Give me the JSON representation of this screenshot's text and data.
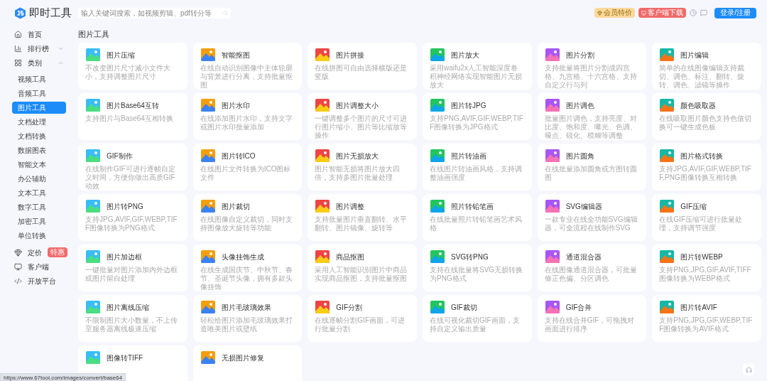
{
  "header": {
    "logo": "即时工具",
    "search": {
      "placeholder": "输入关键词搜索，如视频剪辑、pdf转分等"
    },
    "vip_button": "会员特价",
    "download_button": "客户端下载",
    "login_button": "登录/注册"
  },
  "sidebar": {
    "items": [
      {
        "label": "首页",
        "selected": false
      },
      {
        "label": "排行榜",
        "selected": false,
        "expanded": false
      },
      {
        "label": "类别",
        "selected": false,
        "expanded": true,
        "children": [
          {
            "label": "视频工具",
            "selected": false
          },
          {
            "label": "音频工具",
            "selected": false
          },
          {
            "label": "图片工具",
            "selected": true
          },
          {
            "label": "文档处理",
            "selected": false
          },
          {
            "label": "文档转换",
            "selected": false
          },
          {
            "label": "数据图表",
            "selected": false
          },
          {
            "label": "智能文本",
            "selected": false
          },
          {
            "label": "办公辅助",
            "selected": false
          },
          {
            "label": "文本工具",
            "selected": false
          },
          {
            "label": "数字工具",
            "selected": false
          },
          {
            "label": "加密工具",
            "selected": false
          },
          {
            "label": "单位转换",
            "selected": false
          }
        ]
      },
      {
        "label": "定价",
        "selected": false,
        "badge": "特惠"
      },
      {
        "label": "客户端",
        "selected": false
      },
      {
        "label": "开放平台",
        "selected": false
      }
    ]
  },
  "page_title": "图片工具",
  "tools": [
    {
      "title": "图片压缩",
      "description": "不改变图片尺寸减小文件大小，支持调整图片尺寸"
    },
    {
      "title": "智能抠图",
      "description": "在线自动识别图像中主体轮廓与背景进行分离，支持批量抠图"
    },
    {
      "title": "图片拼接",
      "description": "在线拼图可自由选择横版还是竖版"
    },
    {
      "title": "图片放大",
      "description": "采用waifu2x人工智能深度卷积神经网络实现智能图片无损放大"
    },
    {
      "title": "图片分割",
      "description": "支持批量将图片分割成四宫格、九宫格、十六宫格、支持自定义行与列"
    },
    {
      "title": "图片编辑",
      "description": "简单的在线图像编辑支持裁切、调色、标注、翻转、旋转、调色、滤镜等操作"
    },
    {
      "title": "图片Base64互转",
      "description": "支持图片与Base64互相转换"
    },
    {
      "title": "图片水印",
      "description": "在线添加图片水印，支持文字或图片水印批量添加"
    },
    {
      "title": "图片调整大小",
      "description": "一键调整多个图片的尺寸可进行图片缩小、图片等比缩放等操作"
    },
    {
      "title": "图片转JPG",
      "description": "支持PNG,AVIF,GIF,WEBP,TIFF图像转换为JPG格式"
    },
    {
      "title": "图片调色",
      "description": "批量图片调色，支持亮度、对比度、饱和度、曝光、色调、噪点、锐化、模糊等调整"
    },
    {
      "title": "颜色吸取器",
      "description": "在线吸取图片颜色支持色值切换可一键生成色板"
    },
    {
      "title": "GIF制作",
      "description": "在线制作GIF可进行逐帧自定义时间，方便你做出高质GIF动效"
    },
    {
      "title": "图片转ICO",
      "description": "在线图片文件转换为ICO图标文件"
    },
    {
      "title": "图片无损放大",
      "description": "图片智能无损将图片放大四倍，支持多图片批量处理"
    },
    {
      "title": "照片转油画",
      "description": "在线图片转油画风格，支持调整油画强度"
    },
    {
      "title": "图片圆角",
      "description": "在线批量添加圆角或方图转圆图"
    },
    {
      "title": "图片格式转换",
      "description": "支持JPG,AVIF,GIF,WEBP,TIFF,PNG图像转换互相转换"
    },
    {
      "title": "图片转PNG",
      "description": "支持JPG,AVIF,GIF,WEBP,TIFF图像转换为PNG格式"
    },
    {
      "title": "图片裁切",
      "description": "在线图像自定义裁切，同时支持图像放大旋转等功能"
    },
    {
      "title": "图片调整",
      "description": "支持批量图片垂直翻转、水平翻转、图片镜像、旋转等"
    },
    {
      "title": "照片转铅笔画",
      "description": "在线批量照片转铅笔画艺术风格"
    },
    {
      "title": "SVG编辑器",
      "description": "一款专业在线全功能SVG编辑器，可全流程在线制作SVG"
    },
    {
      "title": "GIF压缩",
      "description": "在线GIF压缩可进行批量处理，支持调节强度"
    },
    {
      "title": "图片加边框",
      "description": "一键批量对图片添加内外边框或图片留白处理"
    },
    {
      "title": "头像挂饰生成",
      "description": "在线生成国庆节、中秋节、春节、圣诞节头像，拥有多款头像挂饰"
    },
    {
      "title": "商品抠图",
      "description": "采用人工智能识别图片中商品实现商品抠图，支持批量抠图"
    },
    {
      "title": "SVG转PNG",
      "description": "支持在线批量将SVG无损转换为PNG格式"
    },
    {
      "title": "通道混合器",
      "description": "在线图像通道混合器，可批量修正色偏、分区调色"
    },
    {
      "title": "图片转WEBP",
      "description": "支持PNG,JPG,GIF,AVIF,TIFF图像转换为WEBP格式"
    },
    {
      "title": "图片离线压缩",
      "description": "不限制图片大小数量，不上传至服务器离线极速压缩"
    },
    {
      "title": "图片毛玻璃效果",
      "description": "轻松给图片添加毛玻璃效果打造唯美图片或壁纸"
    },
    {
      "title": "GIF分割",
      "description": "在线逐帧分割GIF画面，可进行批量分割"
    },
    {
      "title": "GIF裁切",
      "description": "在线可视化裁切GIF画面，支持自定义输出质量"
    },
    {
      "title": "GIF合并",
      "description": "支持在线合并GIF，可拖拽对画面进行排序"
    },
    {
      "title": "图片转AVIF",
      "description": "支持PNG,JPG,GIF,WEBP,TIFF图像转换为AVIF格式"
    },
    {
      "title": "图像转TIFF"
    },
    {
      "title": "无损图片修复"
    }
  ],
  "status_bar": {
    "url": "https://www.67tool.com/images/convert/base64"
  }
}
